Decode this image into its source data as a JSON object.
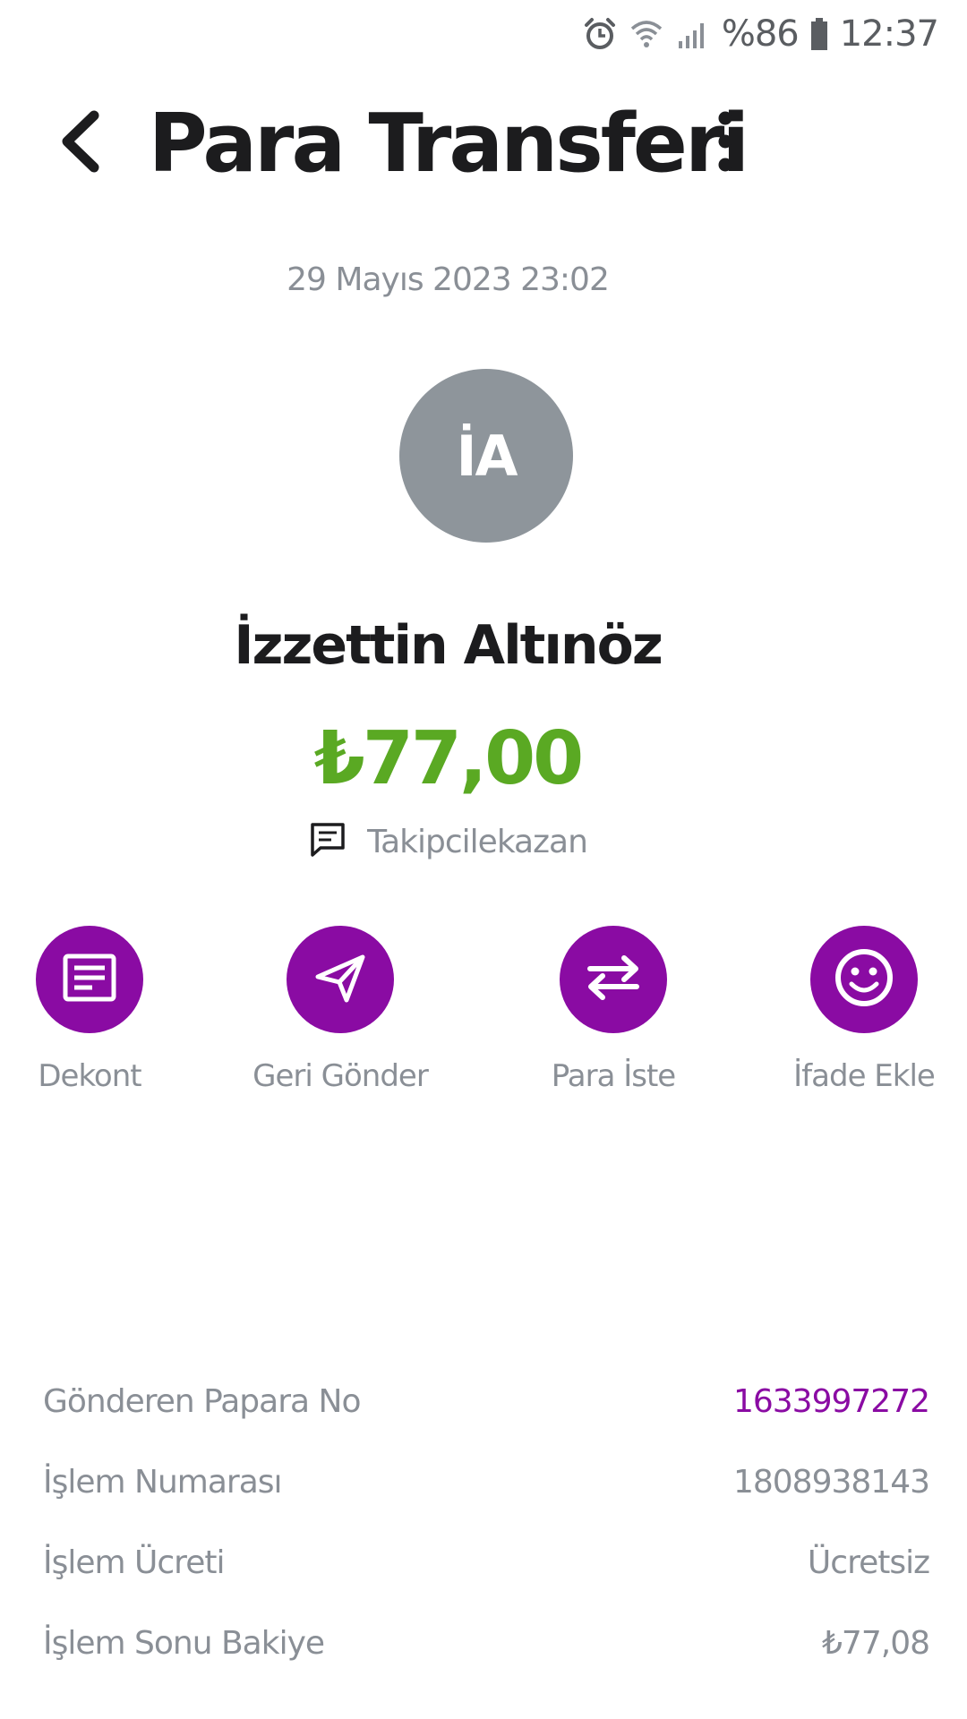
{
  "status_bar": {
    "battery": "%86",
    "time": "12:37",
    "icons": [
      "alarm-icon",
      "wifi-icon",
      "signal-icon",
      "battery-icon"
    ]
  },
  "header": {
    "title": "Para Transferi",
    "back_icon": "back-chevron-icon",
    "menu_icon": "more-vertical-icon"
  },
  "transaction": {
    "date": "29 Mayıs 2023 23:02",
    "avatar_initials": "İA",
    "recipient_name": "İzzettin Altınöz",
    "amount": "₺77,00",
    "note_icon": "comment-icon",
    "note": "Takipcilekazan"
  },
  "actions": [
    {
      "label": "Dekont",
      "icon": "receipt-icon"
    },
    {
      "label": "Geri Gönder",
      "icon": "send-icon"
    },
    {
      "label": "Para İste",
      "icon": "swap-arrows-icon"
    },
    {
      "label": "İfade Ekle",
      "icon": "smiley-icon"
    }
  ],
  "details": [
    {
      "label": "Gönderen Papara No",
      "value": "1633997272"
    },
    {
      "label": "İşlem Numarası",
      "value": "1808938143"
    },
    {
      "label": "İşlem Ücreti",
      "value": "Ücretsiz"
    },
    {
      "label": "İşlem Sonu Bakiye",
      "value": "₺77,08"
    }
  ],
  "colors": {
    "accent": "#8a0ba3",
    "amount": "#5aa923",
    "avatar_bg": "#8e959b",
    "muted_text": "#8a8f96",
    "title_text": "#1c1c1e"
  }
}
